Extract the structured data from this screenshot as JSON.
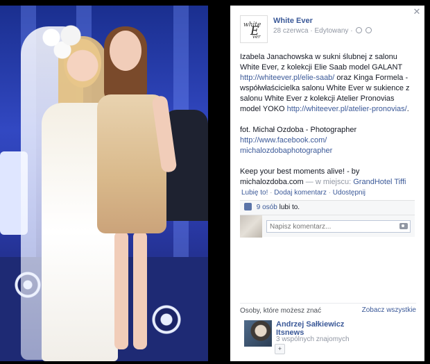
{
  "page": {
    "name": "White Ever",
    "avatar_text_top": "white",
    "avatar_text_big": "E",
    "avatar_text_bottom": "ver",
    "date": "28 czerwca",
    "separator": "·",
    "edited": "Edytowany"
  },
  "post": {
    "p1_text_a": "Izabela Janachowska w sukni ślubnej z salonu White Ever, z kolekcji Elie Saab model GALANT",
    "p1_link_a": "http://whiteever.pl/elie-saab/",
    "p1_text_b": "oraz Kinga Formela - współwłaścicielka salonu White Ever w sukience z salonu White Ever z kolekcji Atelier Pronovias model YOKO",
    "p1_link_b": "http://whiteever.pl/atelier-pronovias/",
    "p1_end": ".",
    "p2_text": "fot. Michał Ozdoba - Photographer",
    "p2_link_a": "http://www.facebook.com/",
    "p2_link_b": "michalozdobaphotographer",
    "p3_text": "Keep your best moments alive! - by michalozdoba.com",
    "p3_place_prefix": "— w miejscu:",
    "p3_place": "GrandHotel Tiffi"
  },
  "actions": {
    "like": "Lubię to!",
    "comment": "Dodaj komentarz",
    "share": "Udostępnij",
    "sep": "·"
  },
  "ufi": {
    "likes_link": "9 osób",
    "likes_suffix": "lubi to.",
    "comment_placeholder": "Napisz komentarz..."
  },
  "pymk": {
    "title": "Osoby, które możesz znać",
    "see_all": "Zobacz wszystkie",
    "person_name": "Andrzej Sałkiewicz Itsnews",
    "mutual": "3 wspólnych znajomych"
  },
  "icons": {
    "close": "close-icon",
    "clock": "clock-icon",
    "globe": "globe-icon",
    "like": "thumbs-up-icon",
    "camera": "camera-icon",
    "add_friend": "add-friend-icon"
  },
  "colors": {
    "link": "#3b5998",
    "muted": "#9197a3",
    "background": "#000000"
  }
}
